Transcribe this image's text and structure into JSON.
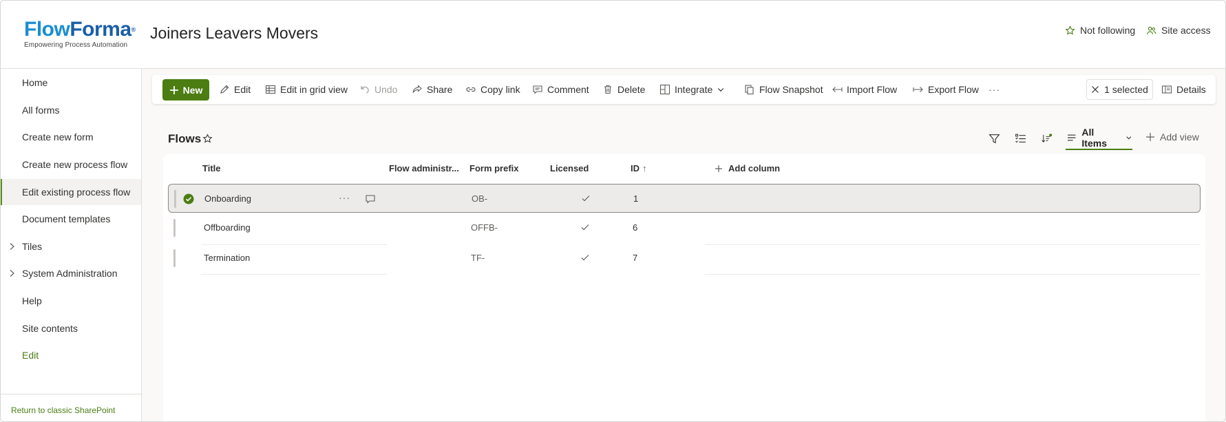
{
  "header": {
    "logo_word_a": "Flow",
    "logo_word_b": "Forma",
    "logo_reg": "®",
    "logo_tagline": "Empowering Process Automation",
    "site_title": "Joiners Leavers Movers",
    "follow_label": "Not following",
    "site_access_label": "Site access"
  },
  "nav": {
    "items": [
      {
        "label": "Home"
      },
      {
        "label": "All forms"
      },
      {
        "label": "Create new form"
      },
      {
        "label": "Create new process flow"
      },
      {
        "label": "Edit existing process flow"
      },
      {
        "label": "Document templates"
      },
      {
        "label": "Tiles"
      },
      {
        "label": "System Administration"
      },
      {
        "label": "Help"
      },
      {
        "label": "Site contents"
      },
      {
        "label": "Edit"
      }
    ],
    "footer_link": "Return to classic SharePoint"
  },
  "commandbar": {
    "new": "New",
    "edit": "Edit",
    "edit_grid": "Edit in grid view",
    "undo": "Undo",
    "share": "Share",
    "copy_link": "Copy link",
    "comment": "Comment",
    "delete": "Delete",
    "integrate": "Integrate",
    "flow_snapshot": "Flow Snapshot",
    "import_flow": "Import Flow",
    "export_flow": "Export Flow",
    "more": "···",
    "selected": "1 selected",
    "details": "Details"
  },
  "list": {
    "title": "Flows",
    "view_name": "All Items",
    "add_view": "Add view",
    "columns": {
      "title": "Title",
      "flow_admin": "Flow administr...",
      "form_prefix": "Form prefix",
      "licensed": "Licensed",
      "id": "ID",
      "id_sort": "↑",
      "add_column": "Add column"
    },
    "rows": [
      {
        "title": "Onboarding",
        "prefix": "OB-",
        "id": "1",
        "row_more": "···"
      },
      {
        "title": "Offboarding",
        "prefix": "OFFB-",
        "id": "6"
      },
      {
        "title": "Termination",
        "prefix": "TF-",
        "id": "7"
      }
    ]
  },
  "colors": {
    "accent_green": "#4b7d12",
    "logo_blue": "#1b8ed1",
    "logo_dark_blue": "#1b5fa8"
  }
}
